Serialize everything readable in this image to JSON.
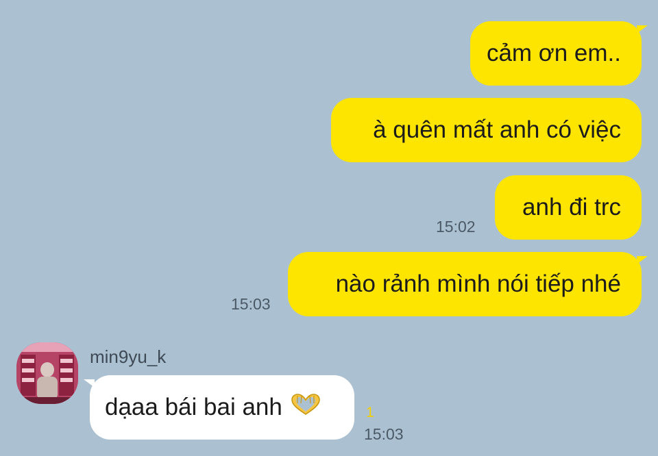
{
  "colors": {
    "background": "#abc1d1",
    "outgoing_bubble": "#fee500",
    "incoming_bubble": "#ffffff",
    "timestamp": "#4b5966",
    "unread": "#f2d000"
  },
  "messages": [
    {
      "direction": "out",
      "text": "cảm ơn em..",
      "time": ""
    },
    {
      "direction": "out",
      "text": "à quên mất anh có việc",
      "time": ""
    },
    {
      "direction": "out",
      "text": "anh đi trc",
      "time": "15:02"
    },
    {
      "direction": "out",
      "text": "nào rảnh mình nói tiếp nhé",
      "time": "15:03"
    }
  ],
  "incoming": {
    "sender": "min9yu_k",
    "avatar_icon": "profile-photo-avatar",
    "text": "dạaa bái bai anh",
    "emoji_icon": "heart-hands-icon",
    "unread_count": "1",
    "time": "15:03"
  }
}
